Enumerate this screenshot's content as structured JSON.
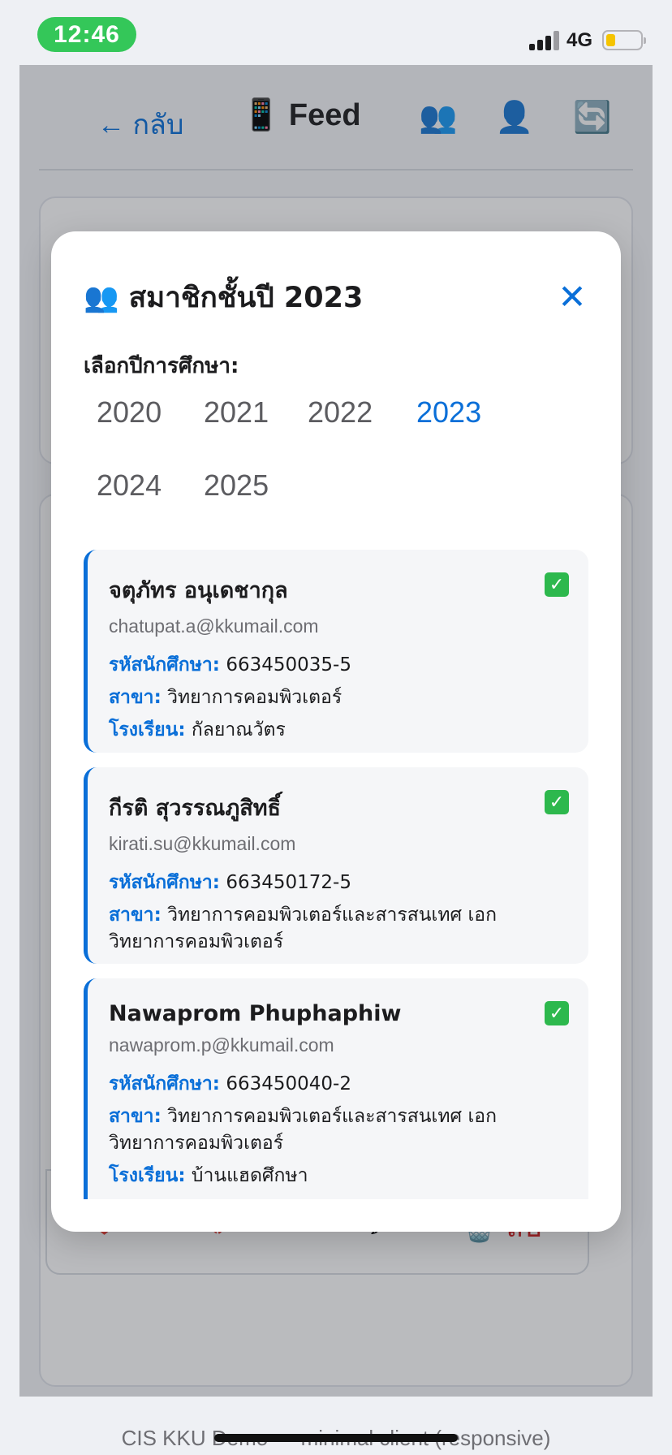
{
  "status_bar": {
    "time": "12:46",
    "network": "4G",
    "battery_level": 0.25
  },
  "app": {
    "back_label": "← กลับ",
    "feed_title": "📱 Feed",
    "icons": [
      "members-icon",
      "profile-icon",
      "refresh-icon"
    ],
    "actions": {
      "like": "❤️ 1",
      "unlike": "💔 Unlike",
      "comments": "💬 0",
      "delete": "🗑️ ลบ"
    },
    "footer": "CIS KKU Demo — minimal client (responsive)"
  },
  "modal": {
    "title": "👥 สมาชิกชั้นปี 2023",
    "close": "✕",
    "year_label": "เลือกปีการศึกษา:",
    "years": [
      "2020",
      "2021",
      "2022",
      "2023",
      "2024",
      "2025"
    ],
    "selected_year": "2023",
    "labels": {
      "student_id": "รหัสนักศึกษา:",
      "major": "สาขา:",
      "school": "โรงเรียน:"
    },
    "members": [
      {
        "name": "จตุภัทร อนุเดชากุล",
        "email": "chatupat.a@kkumail.com",
        "student_id": "663450035-5",
        "major": "วิทยาการคอมพิวเตอร์",
        "school": "กัลยาณวัตร",
        "verified": "✓"
      },
      {
        "name": "กีรติ สุวรรณภูสิทธิ์",
        "email": "kirati.su@kkumail.com",
        "student_id": "663450172-5",
        "major": "วิทยาการคอมพิวเตอร์และสารสนเทศ เอกวิทยาการคอมพิวเตอร์",
        "verified": "✓"
      },
      {
        "name": "Nawaprom Phuphaphiw",
        "email": "nawaprom.p@kkumail.com",
        "student_id": "663450040-2",
        "major": "วิทยาการคอมพิวเตอร์และสารสนเทศ เอกวิทยาการคอมพิวเตอร์",
        "school": "บ้านแฮดศึกษา",
        "verified": "✓"
      }
    ]
  }
}
